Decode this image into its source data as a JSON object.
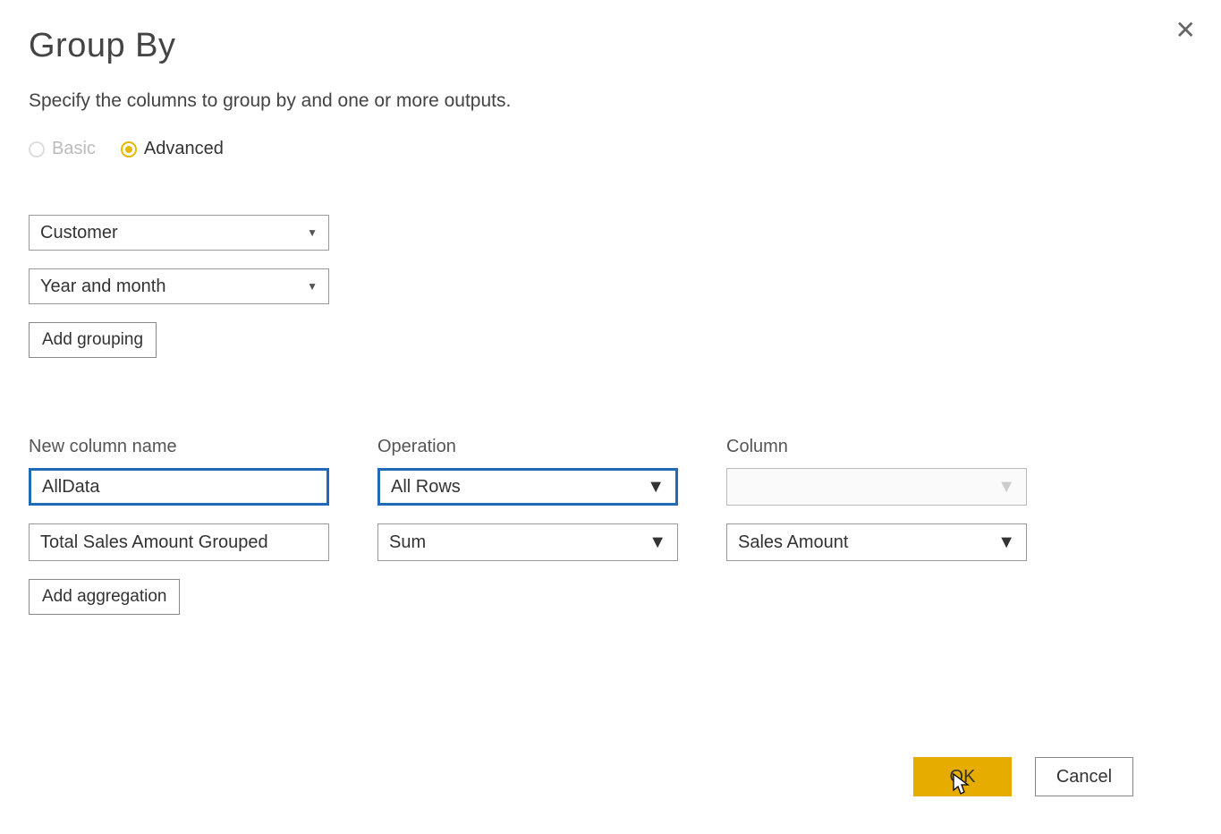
{
  "dialog": {
    "title": "Group By",
    "subtitle": "Specify the columns to group by and one or more outputs."
  },
  "mode": {
    "basic_label": "Basic",
    "advanced_label": "Advanced"
  },
  "groupings": [
    {
      "value": "Customer"
    },
    {
      "value": "Year and month"
    }
  ],
  "buttons": {
    "add_grouping": "Add grouping",
    "add_aggregation": "Add aggregation",
    "ok": "OK",
    "cancel": "Cancel"
  },
  "headers": {
    "new_column": "New column name",
    "operation": "Operation",
    "column": "Column"
  },
  "aggregations": [
    {
      "name": "AllData",
      "operation": "All Rows",
      "column": "",
      "column_disabled": true,
      "highlighted": true
    },
    {
      "name": "Total Sales Amount Grouped",
      "operation": "Sum",
      "column": "Sales Amount",
      "column_disabled": false,
      "highlighted": false
    }
  ]
}
